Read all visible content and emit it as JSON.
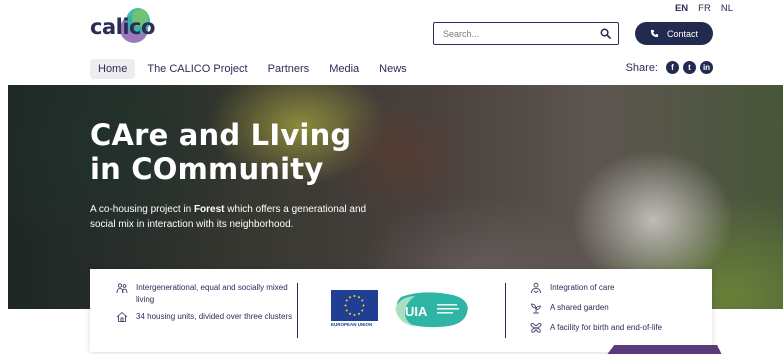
{
  "brand": {
    "logo_text": "calico"
  },
  "languages": [
    {
      "code": "EN",
      "active": true
    },
    {
      "code": "FR",
      "active": false
    },
    {
      "code": "NL",
      "active": false
    }
  ],
  "search": {
    "placeholder": "Search..."
  },
  "contact": {
    "label": "Contact"
  },
  "nav": {
    "items": [
      {
        "label": "Home",
        "active": true
      },
      {
        "label": "The CALICO Project",
        "active": false
      },
      {
        "label": "Partners",
        "active": false
      },
      {
        "label": "Media",
        "active": false
      },
      {
        "label": "News",
        "active": false
      }
    ]
  },
  "share": {
    "label": "Share:",
    "networks": [
      "facebook-icon",
      "twitter-icon",
      "linkedin-icon"
    ],
    "glyphs": [
      "f",
      "t",
      "in"
    ]
  },
  "hero": {
    "title_line1": "CAre and LIving",
    "title_line2": "in COmmunity",
    "desc_before": "A co-housing project in ",
    "desc_bold": "Forest",
    "desc_after": " which offers a generational and social mix in interaction with its neighborhood."
  },
  "features_left": [
    {
      "icon": "people-icon",
      "text": "Intergenerational, equal and socially mixed living"
    },
    {
      "icon": "house-icon",
      "text": "34 housing units, divided over three clusters"
    }
  ],
  "partners": {
    "eu_label": "EUROPEAN UNION",
    "uia_label": "UIA"
  },
  "features_right": [
    {
      "icon": "care-icon",
      "text": "Integration of care"
    },
    {
      "icon": "plant-icon",
      "text": "A shared garden"
    },
    {
      "icon": "butterfly-icon",
      "text": "A facility for birth and end-of-life"
    }
  ],
  "colors": {
    "navy": "#232a4f",
    "eu_blue": "#1f3e94",
    "uia_teal": "#2fb5a6",
    "accent_purple": "#5a3a7a"
  }
}
